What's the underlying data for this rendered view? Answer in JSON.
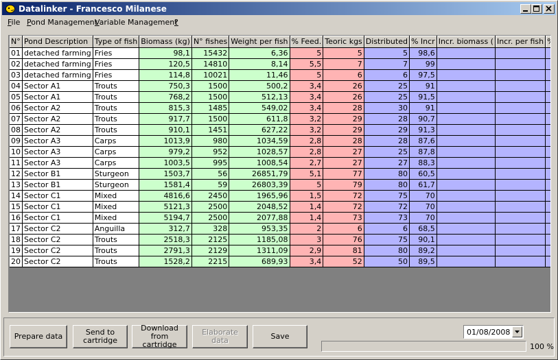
{
  "window": {
    "title": "Datalinker - Francesco Milanese"
  },
  "menu": [
    {
      "label": "File",
      "u": "F",
      "rest": "ile"
    },
    {
      "label": "Pond Management",
      "u": "P",
      "rest": "ond Management"
    },
    {
      "label": "Variable Management",
      "u": "V",
      "rest": "ariable Management"
    },
    {
      "label": "?",
      "u": "?",
      "rest": ""
    }
  ],
  "columns": [
    "N°",
    "Pond Description",
    "Type of fish",
    "Biomass (kg)",
    "N° fishes",
    "Weight per fish",
    "% Feed.",
    "Teoric kgs",
    "Distributed",
    "% Incr",
    "Incr. biomass (",
    "Incr. per fish",
    "% tot. tod"
  ],
  "rows": [
    [
      "01",
      "detached farming",
      "Fries",
      "98,1",
      "15432",
      "6,36",
      "5",
      "5",
      "5",
      "98,6",
      "",
      "",
      ""
    ],
    [
      "02",
      "detached farming",
      "Fries",
      "120,5",
      "14810",
      "8,14",
      "5,5",
      "7",
      "7",
      "99",
      "",
      "",
      ""
    ],
    [
      "03",
      "detached farming",
      "Fries",
      "114,8",
      "10021",
      "11,46",
      "5",
      "6",
      "6",
      "97,5",
      "",
      "",
      ""
    ],
    [
      "04",
      "Sector A1",
      "Trouts",
      "750,3",
      "1500",
      "500,2",
      "3,4",
      "26",
      "25",
      "91",
      "",
      "",
      ""
    ],
    [
      "05",
      "Sector A1",
      "Trouts",
      "768,2",
      "1500",
      "512,13",
      "3,4",
      "26",
      "25",
      "91,5",
      "",
      "",
      ""
    ],
    [
      "06",
      "Sector A2",
      "Trouts",
      "815,3",
      "1485",
      "549,02",
      "3,4",
      "28",
      "30",
      "91",
      "",
      "",
      ""
    ],
    [
      "07",
      "Sector A2",
      "Trouts",
      "917,7",
      "1500",
      "611,8",
      "3,2",
      "29",
      "28",
      "90,7",
      "",
      "",
      ""
    ],
    [
      "08",
      "Sector A2",
      "Trouts",
      "910,1",
      "1451",
      "627,22",
      "3,2",
      "29",
      "29",
      "91,3",
      "",
      "",
      ""
    ],
    [
      "09",
      "Sector A3",
      "Carps",
      "1013,9",
      "980",
      "1034,59",
      "2,8",
      "28",
      "28",
      "87,6",
      "",
      "",
      ""
    ],
    [
      "10",
      "Sector A3",
      "Carps",
      "979,2",
      "952",
      "1028,57",
      "2,8",
      "27",
      "25",
      "87,8",
      "",
      "",
      ""
    ],
    [
      "11",
      "Sector A3",
      "Carps",
      "1003,5",
      "995",
      "1008,54",
      "2,7",
      "27",
      "27",
      "88,3",
      "",
      "",
      ""
    ],
    [
      "12",
      "Sector B1",
      "Sturgeon",
      "1503,7",
      "56",
      "26851,79",
      "5,1",
      "77",
      "80",
      "60,5",
      "",
      "",
      ""
    ],
    [
      "13",
      "Sector B1",
      "Sturgeon",
      "1581,4",
      "59",
      "26803,39",
      "5",
      "79",
      "80",
      "61,7",
      "",
      "",
      ""
    ],
    [
      "14",
      "Sector C1",
      "Mixed",
      "4816,6",
      "2450",
      "1965,96",
      "1,5",
      "72",
      "75",
      "70",
      "",
      "",
      ""
    ],
    [
      "15",
      "Sector C1",
      "Mixed",
      "5121,3",
      "2500",
      "2048,52",
      "1,4",
      "72",
      "72",
      "70",
      "",
      "",
      ""
    ],
    [
      "16",
      "Sector C1",
      "Mixed",
      "5194,7",
      "2500",
      "2077,88",
      "1,4",
      "73",
      "73",
      "70",
      "",
      "",
      ""
    ],
    [
      "17",
      "Sector C2",
      "Anguilla",
      "312,7",
      "328",
      "953,35",
      "2",
      "6",
      "6",
      "68,5",
      "",
      "",
      ""
    ],
    [
      "18",
      "Sector C2",
      "Trouts",
      "2518,3",
      "2125",
      "1185,08",
      "3",
      "76",
      "75",
      "90,1",
      "",
      "",
      ""
    ],
    [
      "19",
      "Sector C2",
      "Trouts",
      "2791,3",
      "2129",
      "1311,09",
      "2,9",
      "81",
      "80",
      "89,2",
      "",
      "",
      ""
    ],
    [
      "20",
      "Sector C2",
      "Trouts",
      "1528,2",
      "2215",
      "689,93",
      "3,4",
      "52",
      "50",
      "89,5",
      "",
      "",
      ""
    ]
  ],
  "buttons": {
    "prepare": "Prepare data",
    "send": "Send to cartridge",
    "download": "Download from cartridge",
    "elaborate": "Elaborate data",
    "save": "Save"
  },
  "date": "01/08/2008",
  "progress": {
    "value": 100,
    "label": "100 %"
  },
  "colors": {
    "green": "#ccffcc",
    "red": "#ffb4b4",
    "blue": "#b4b4ff",
    "titlebar": "#0a246a"
  }
}
